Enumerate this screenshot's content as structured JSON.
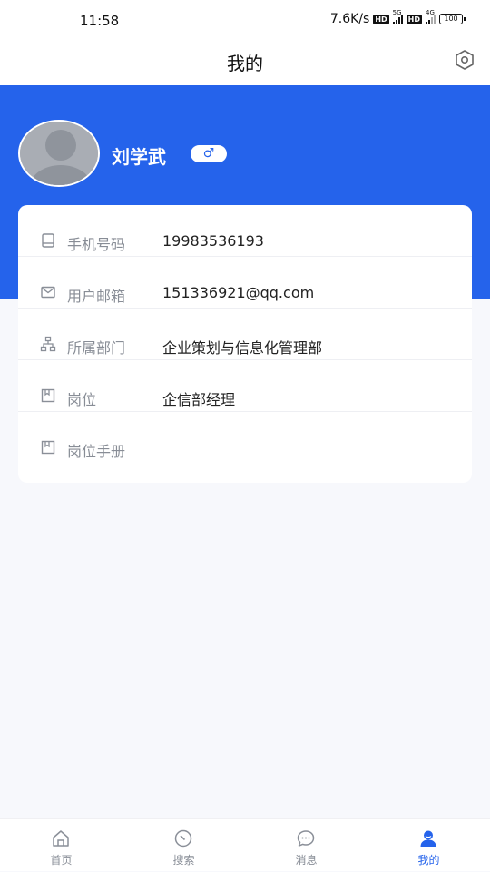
{
  "status_bar": {
    "time": "11:58",
    "speed": "7.6K/s",
    "hd": "HD",
    "net1": "5G",
    "net2": "4G",
    "battery": "100"
  },
  "header": {
    "title": "我的"
  },
  "profile": {
    "name": "刘学武",
    "gender_symbol": "♂"
  },
  "info": {
    "rows": [
      {
        "label": "手机号码",
        "value": "19983536193",
        "icon": "phone-icon"
      },
      {
        "label": "用户邮箱",
        "value": "151336921@qq.com",
        "icon": "mail-icon"
      },
      {
        "label": "所属部门",
        "value": "企业策划与信息化管理部",
        "icon": "org-icon"
      },
      {
        "label": "岗位",
        "value": "企信部经理",
        "icon": "bookmark-icon"
      },
      {
        "label": "岗位手册",
        "value": "",
        "icon": "bookmark-icon"
      }
    ]
  },
  "tabs": [
    {
      "label": "首页",
      "icon": "home-icon"
    },
    {
      "label": "搜索",
      "icon": "compass-icon"
    },
    {
      "label": "消息",
      "icon": "chat-icon"
    },
    {
      "label": "我的",
      "icon": "user-icon"
    }
  ],
  "colors": {
    "accent": "#2563eb",
    "page_bg": "#f7f8fc"
  }
}
